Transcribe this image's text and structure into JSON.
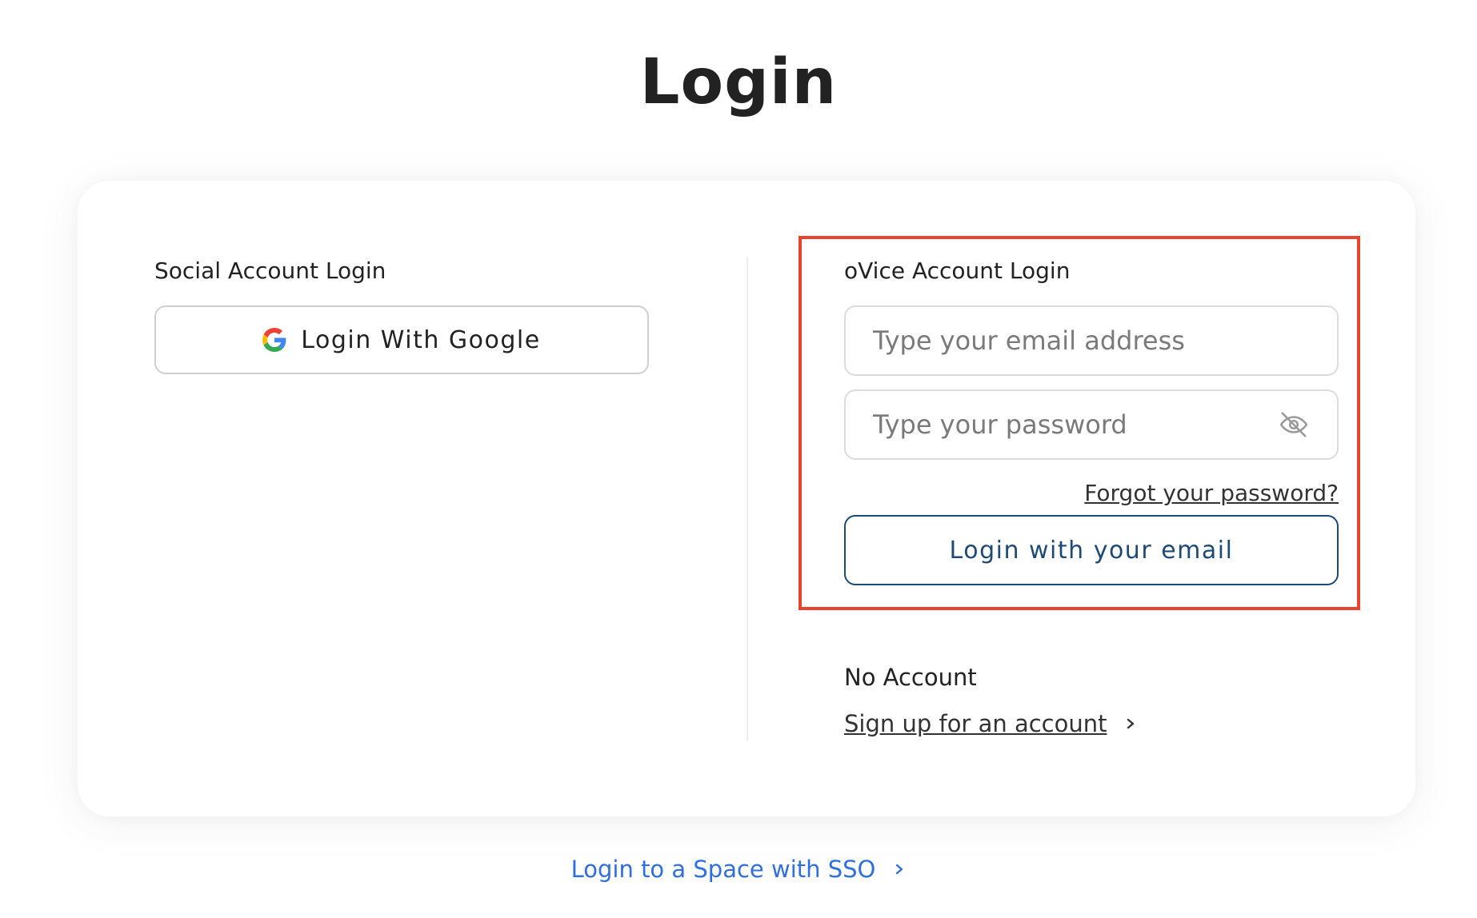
{
  "page": {
    "title": "Login"
  },
  "social": {
    "label": "Social Account Login",
    "google_button_label": "Login With Google",
    "google_icon": "google-g-icon"
  },
  "ovice": {
    "label": "oVice Account Login",
    "email_placeholder": "Type your email address",
    "password_placeholder": "Type your password",
    "password_toggle_icon": "eye-off-icon",
    "forgot_password": "Forgot your password?",
    "login_button_label": "Login with your email"
  },
  "no_account": {
    "label": "No Account",
    "signup_link": "Sign up for an account"
  },
  "sso": {
    "link": "Login to a Space with SSO"
  },
  "colors": {
    "highlight": "#e8432e",
    "primary_button": "#1e4a78",
    "sso_link": "#2f6fe0"
  }
}
